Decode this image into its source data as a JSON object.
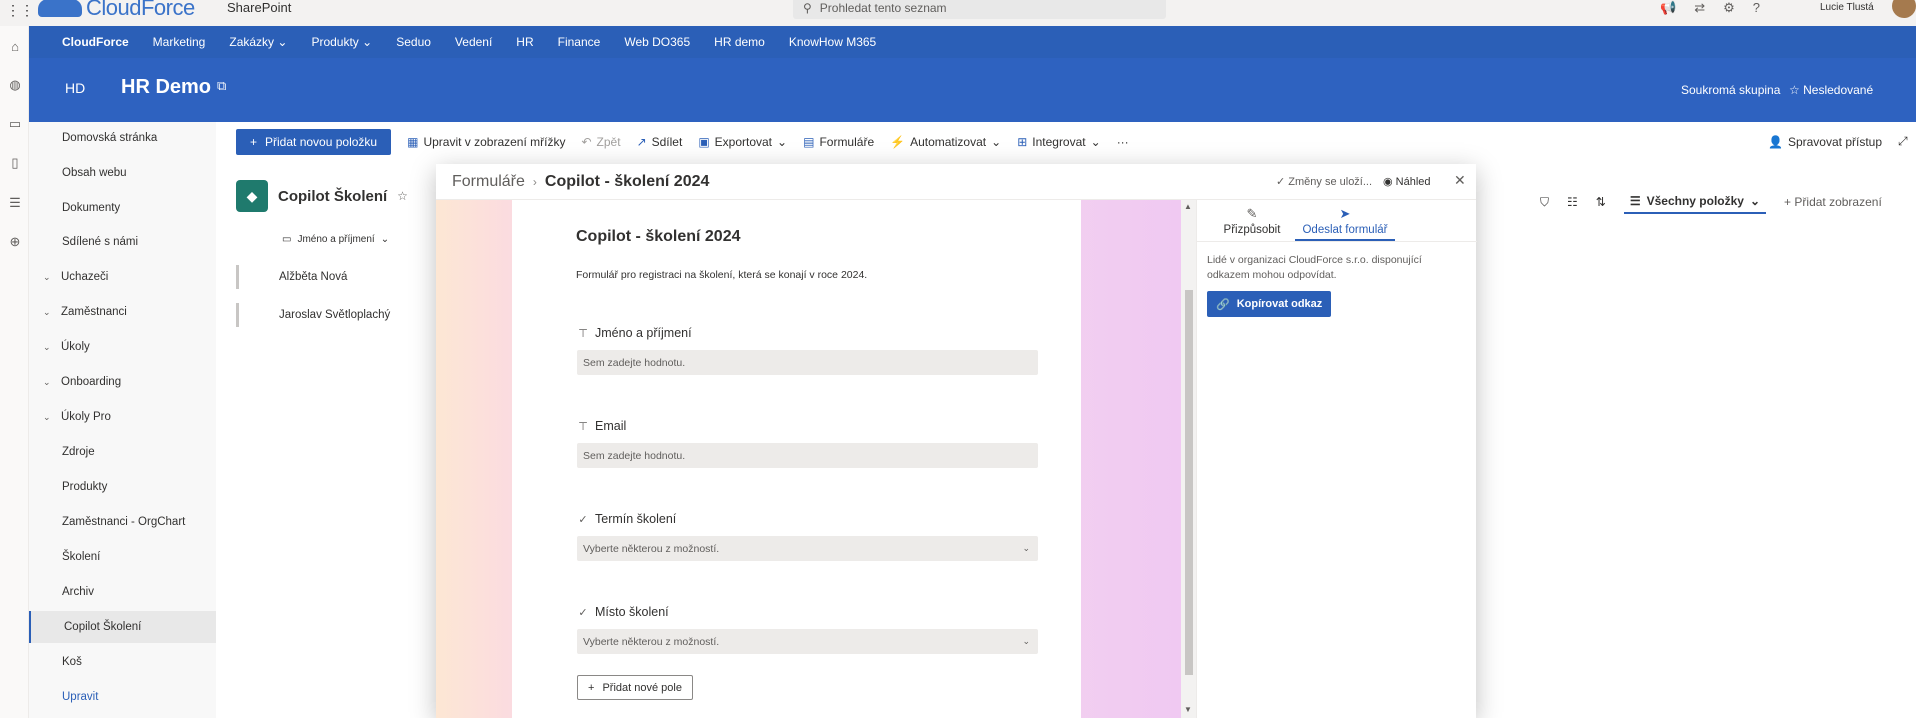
{
  "suite": {
    "brand": "CloudForce",
    "app_name": "SharePoint",
    "search_placeholder": "Prohledat tento seznam",
    "user_name": "Lucie Tlustá"
  },
  "hubnav": {
    "items": [
      "CloudForce",
      "Marketing",
      "Zakázky",
      "Produkty",
      "Seduo",
      "Vedení",
      "HR",
      "Finance",
      "Web DO365",
      "HR demo",
      "KnowHow M365"
    ]
  },
  "site": {
    "initials": "HD",
    "title": "HR Demo",
    "privacy": "Soukromá skupina",
    "follow": "Nesledované"
  },
  "leftnav": {
    "items": [
      "Domovská stránka",
      "Obsah webu",
      "Dokumenty",
      "Sdílené s námi",
      "Uchazeči",
      "Zaměstnanci",
      "Úkoly",
      "Onboarding",
      "Úkoly Pro",
      "Zdroje",
      "Produkty",
      "Zaměstnanci - OrgChart",
      "Školení",
      "Archiv",
      "Copilot Školení",
      "Koš",
      "Upravit"
    ]
  },
  "commandbar": {
    "new_item": "Přidat novou položku",
    "grid_edit": "Upravit v zobrazení mřížky",
    "undo": "Zpět",
    "share": "Sdílet",
    "export": "Exportovat",
    "forms": "Formuláře",
    "automate": "Automatizovat",
    "integrate": "Integrovat",
    "more": "···",
    "manage_access": "Spravovat přístup"
  },
  "list": {
    "title": "Copilot Školení",
    "column_header": "Jméno a příjmení",
    "rows": [
      "Alžběta Nová",
      "Jaroslav Světloplachý"
    ],
    "view_name": "Všechny položky",
    "add_view": "Přidat zobrazení"
  },
  "dialog": {
    "breadcrumb_root": "Formuláře",
    "breadcrumb_current": "Copilot - školení 2024",
    "saved_status": "Změny se uloží...",
    "preview": "Náhled"
  },
  "form": {
    "title": "Copilot - školení 2024",
    "description": "Formulář pro registraci na školení, která se konají v roce 2024.",
    "fields": [
      {
        "label": "Jméno a příjmení",
        "placeholder": "Sem zadejte hodnotu.",
        "kind": "text"
      },
      {
        "label": "Email",
        "placeholder": "Sem zadejte hodnotu.",
        "kind": "text"
      },
      {
        "label": "Termín školení",
        "placeholder": "Vyberte některou z možností.",
        "kind": "choice"
      },
      {
        "label": "Místo školení",
        "placeholder": "Vyberte některou z možností.",
        "kind": "choice"
      }
    ],
    "add_field": "Přidat nové pole"
  },
  "sidepane": {
    "tab_customize": "Přizpůsobit",
    "tab_send": "Odeslat formulář",
    "info": "Lidé v organizaci CloudForce s.r.o. disponující odkazem mohou odpovídat.",
    "copy_link": "Kopírovat odkaz"
  },
  "colors": {
    "accent": "#2b5fb7",
    "hub_bg": "#2b5fb7",
    "site_header_bg": "#2e62c0"
  }
}
